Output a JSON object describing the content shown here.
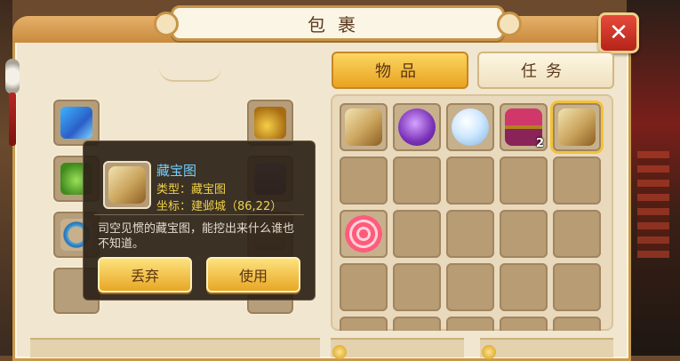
{
  "window": {
    "title": "包裹",
    "close_icon": "close-x-icon"
  },
  "tabs": [
    {
      "label": "物品",
      "active": true
    },
    {
      "label": "任务",
      "active": false
    }
  ],
  "colors": {
    "accent_gold": "#f2c33a",
    "tooltip_title": "#6fd0ff",
    "tooltip_attr": "#f0d24a"
  },
  "equipment_slots": [
    {
      "icon": "scepter-icon"
    },
    {
      "icon": "jade-pendant-icon"
    },
    {
      "icon": "gourd-icon"
    },
    {
      "icon": "armor-icon"
    },
    {
      "icon": "necklace-icon"
    },
    {
      "icon": "belt-icon"
    },
    {
      "icon": "empty-slot"
    },
    {
      "icon": "empty-slot"
    }
  ],
  "inventory": {
    "rows": [
      [
        {
          "icon": "treasure-map-icon",
          "count": ""
        },
        {
          "icon": "purple-pouch-icon",
          "count": ""
        },
        {
          "icon": "crystal-ball-icon",
          "count": ""
        },
        {
          "icon": "treasure-chest-icon",
          "count": "2"
        },
        {
          "icon": "treasure-map-icon",
          "count": "",
          "selected": true
        }
      ],
      [
        {
          "icon": "empty-slot",
          "count": ""
        },
        {
          "icon": "empty-slot",
          "count": ""
        },
        {
          "icon": "empty-slot",
          "count": ""
        },
        {
          "icon": "empty-slot",
          "count": ""
        },
        {
          "icon": "empty-slot",
          "count": ""
        }
      ],
      [
        {
          "icon": "swirl-candy-icon",
          "count": ""
        },
        {
          "icon": "empty-slot",
          "count": ""
        },
        {
          "icon": "empty-slot",
          "count": ""
        },
        {
          "icon": "empty-slot",
          "count": ""
        },
        {
          "icon": "empty-slot",
          "count": ""
        }
      ],
      [
        {
          "icon": "empty-slot",
          "count": ""
        },
        {
          "icon": "empty-slot",
          "count": ""
        },
        {
          "icon": "empty-slot",
          "count": ""
        },
        {
          "icon": "empty-slot",
          "count": ""
        },
        {
          "icon": "empty-slot",
          "count": ""
        }
      ]
    ]
  },
  "tooltip": {
    "item_icon": "treasure-map-icon",
    "name": "藏宝图",
    "type_line": "类型：藏宝图",
    "coord_line": "坐标：建邺城（86,22）",
    "description": "司空见惯的藏宝图，能挖出来什么谁也不知道。",
    "discard_label": "丢弃",
    "use_label": "使用"
  }
}
